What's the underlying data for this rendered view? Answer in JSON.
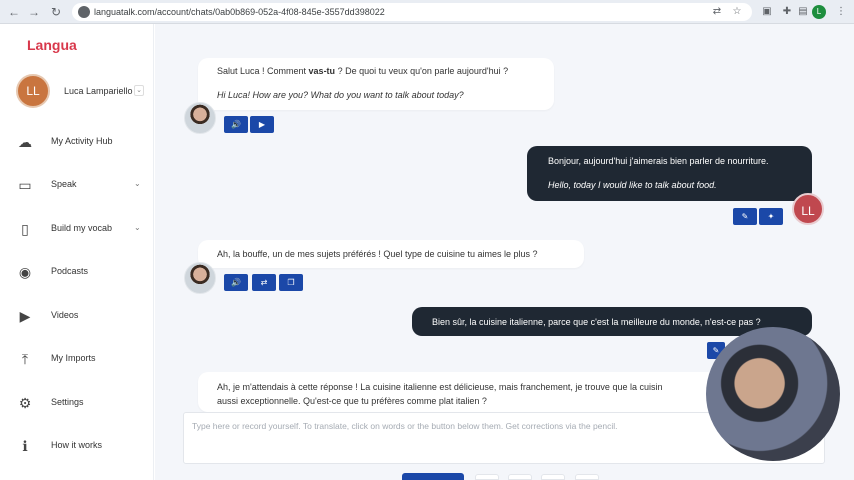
{
  "browser": {
    "url": "languatalk.com/account/chats/0ab0b869-052a-4f08-845e-3557dd398022",
    "profile_initial": "L",
    "nav_icons": [
      "back-icon",
      "forward-icon",
      "reload-icon"
    ],
    "ext_icons": [
      "translate-icon",
      "star-icon",
      "extensions-icon",
      "puzzle-icon",
      "sidebar-icon"
    ]
  },
  "sidebar": {
    "logo": "Langua",
    "user": {
      "initials": "LL",
      "name": "Luca Lampariello"
    },
    "items": [
      {
        "label": "My Activity Hub",
        "icon": "cloud-icon",
        "has_chevron": false
      },
      {
        "label": "Speak",
        "icon": "chat-icon",
        "has_chevron": true
      },
      {
        "label": "Build my vocab",
        "icon": "book-icon",
        "has_chevron": true
      },
      {
        "label": "Podcasts",
        "icon": "microphone-icon",
        "has_chevron": false
      },
      {
        "label": "Videos",
        "icon": "video-icon",
        "has_chevron": false
      },
      {
        "label": "My Imports",
        "icon": "upload-icon",
        "has_chevron": false
      },
      {
        "label": "Settings",
        "icon": "gear-icon",
        "has_chevron": false
      },
      {
        "label": "How it works",
        "icon": "info-icon",
        "has_chevron": false
      }
    ]
  },
  "chat": {
    "messages": [
      {
        "from": "bot",
        "pre": "Salut Luca ! Comment ",
        "bold": "vas-tu",
        "post": " ? De quoi tu veux qu'on parle aujourd'hui ?",
        "translation": "Hi Luca! How are you? What do you want to talk about today?"
      },
      {
        "from": "user",
        "text": "Bonjour, aujourd'hui j'aimerais bien parler de nourriture.",
        "translation": "Hello, today I would like to talk about food.",
        "initials": "LL"
      },
      {
        "from": "bot",
        "text": "Ah, la bouffe, un de mes sujets préférés ! Quel type de cuisine tu aimes le plus ?"
      },
      {
        "from": "user",
        "text": "Bien sûr, la cuisine italienne, parce que c'est la meilleure du monde, n'est-ce pas ?"
      },
      {
        "from": "bot",
        "line1": "Ah, je m'attendais à cette réponse ! La cuisine italienne est délicieuse, mais franchement, je trouve que la cuisin",
        "line2": "aussi exceptionnelle. Qu'est-ce que tu préfères comme plat italien ?"
      }
    ],
    "composer_placeholder": "Type here or record yourself. To translate, click on words or the button below them. Get corrections via the pencil."
  }
}
